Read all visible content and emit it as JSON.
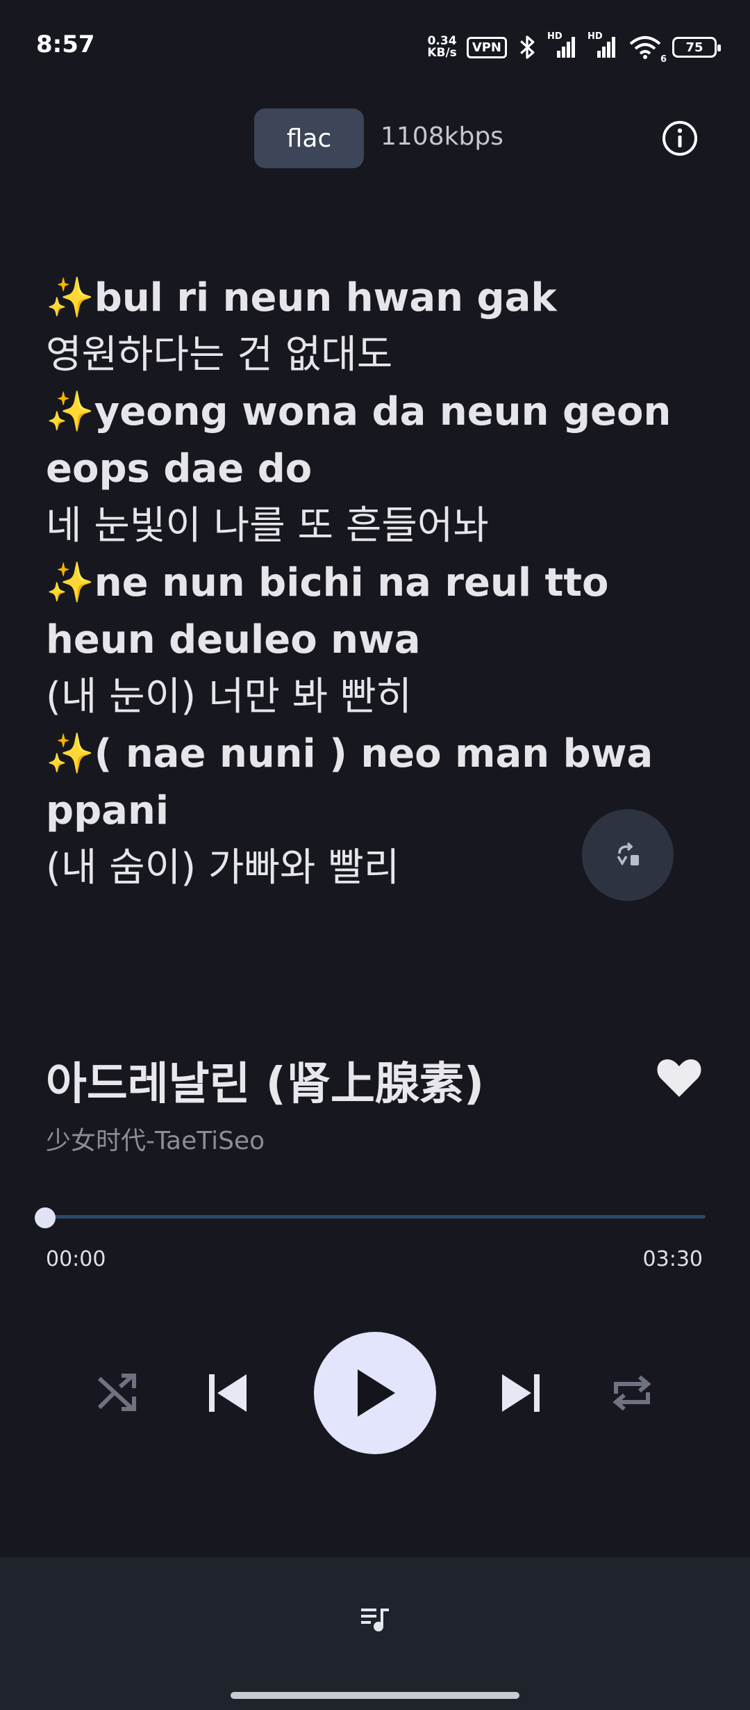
{
  "status_bar": {
    "time": "8:57",
    "net_speed_value": "0.34",
    "net_speed_unit": "KB/s",
    "vpn_label": "VPN",
    "signal1_label": "HD",
    "signal2_label": "HD",
    "wifi_label": "6",
    "battery_level": "75"
  },
  "header": {
    "format": "flac",
    "bitrate": "1108kbps",
    "info_icon": "info-icon"
  },
  "lyrics": [
    {
      "text": "✨bul ri neun hwan gak",
      "kind": "romanized"
    },
    {
      "text": "영원하다는 건 없대도",
      "kind": "original"
    },
    {
      "text": "✨yeong wona da neun geon",
      "kind": "romanized"
    },
    {
      "text": "eops dae do",
      "kind": "romanized"
    },
    {
      "text": "네 눈빛이 나를 또 흔들어놔",
      "kind": "original"
    },
    {
      "text": "✨ne nun bichi na reul tto",
      "kind": "romanized"
    },
    {
      "text": "heun deuleo nwa",
      "kind": "romanized"
    },
    {
      "text": "(내 눈이) 너만 봐 빤히",
      "kind": "original"
    },
    {
      "text": "✨( nae nuni ) neo man bwa",
      "kind": "romanized"
    },
    {
      "text": "ppani",
      "kind": "romanized"
    },
    {
      "text": "(내 숨이) 가빠와 빨리",
      "kind": "original"
    }
  ],
  "song": {
    "title": "아드레날린 (肾上腺素)",
    "artist": "少女时代-TaeTiSeo",
    "favorited": true
  },
  "progress": {
    "elapsed": "00:00",
    "total": "03:30",
    "fraction": 0.0
  },
  "controls": {
    "shuffle_icon": "shuffle-icon",
    "previous_icon": "skip-previous-icon",
    "play_icon": "play-icon",
    "next_icon": "skip-next-icon",
    "repeat_icon": "repeat-icon"
  },
  "colors": {
    "background": "#17181f",
    "accent": "#e2e5fb",
    "chip": "#3c4658",
    "progress_track": "#2d4868"
  }
}
